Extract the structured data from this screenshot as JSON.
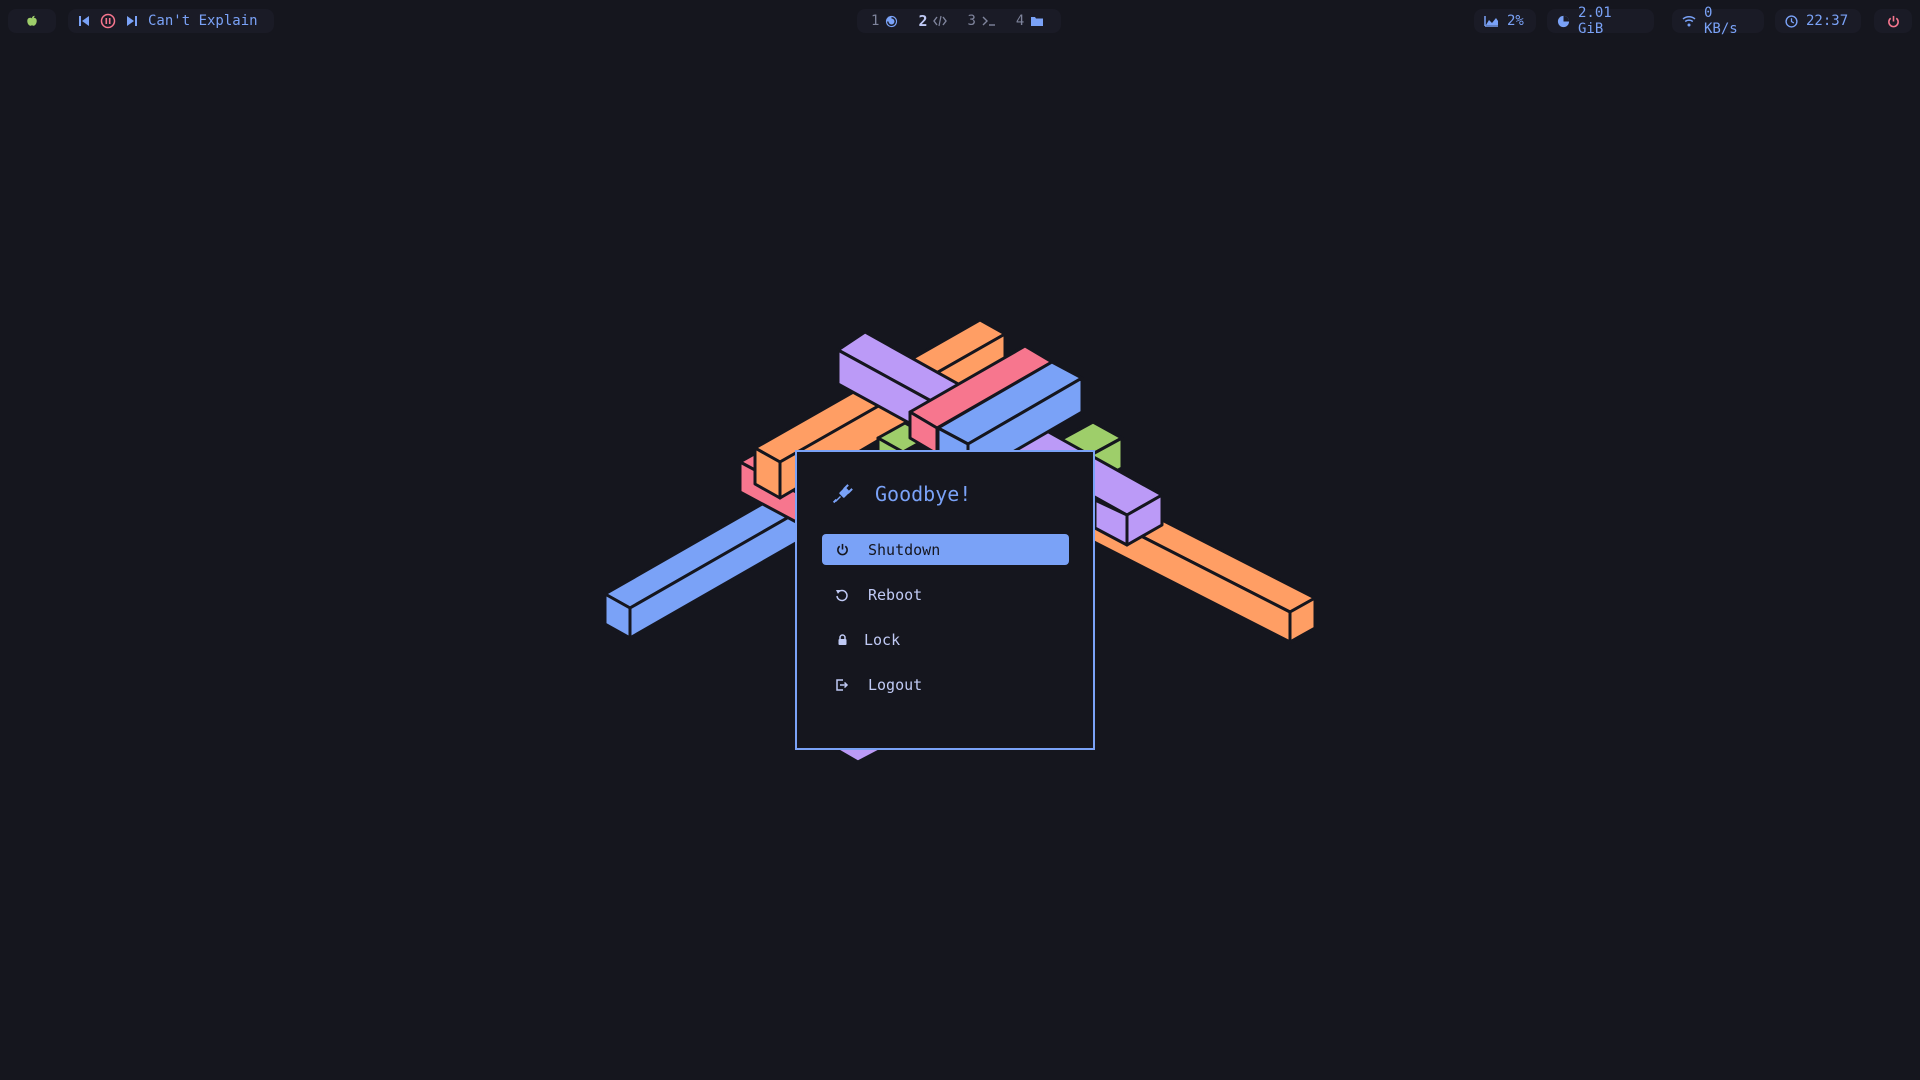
{
  "topbar": {
    "launcher": {
      "icon": "apple-icon",
      "color": "#9ece6a"
    },
    "media": {
      "prev_icon": "skip-previous-icon",
      "pause_icon": "pause-circle-icon",
      "next_icon": "skip-next-icon",
      "title": "Can't Explain",
      "pause_color": "#f7768e"
    },
    "workspaces": [
      {
        "num": "1",
        "icon": "spiral-icon",
        "active": false
      },
      {
        "num": "2",
        "icon": "code-icon",
        "active": true
      },
      {
        "num": "3",
        "icon": "terminal-icon",
        "active": false
      },
      {
        "num": "4",
        "icon": "folder-icon",
        "active": false
      }
    ],
    "stats": {
      "cpu": {
        "icon": "chart-area-icon",
        "value": "2%"
      },
      "memory": {
        "icon": "pie-chart-icon",
        "value": "2.01 GiB"
      },
      "network": {
        "icon": "wifi-icon",
        "value": "0 KB/s"
      },
      "clock": {
        "icon": "clock-icon",
        "value": "22:37"
      }
    },
    "power_icon": "power-icon",
    "power_color": "#f7768e"
  },
  "dialog": {
    "title_icon": "plug-icon",
    "title": "Goodbye!",
    "items": [
      {
        "icon": "power-icon",
        "label": "Shutdown",
        "selected": true
      },
      {
        "icon": "restart-icon",
        "label": "Reboot",
        "selected": false
      },
      {
        "icon": "lock-icon",
        "label": "Lock",
        "selected": false
      },
      {
        "icon": "logout-icon",
        "label": "Logout",
        "selected": false
      }
    ]
  },
  "colors": {
    "background": "#15161e",
    "accent": "#7aa2f7",
    "orange": "#ff9e64",
    "purple": "#bb9af7",
    "red": "#f7768e",
    "green": "#9ece6a"
  }
}
